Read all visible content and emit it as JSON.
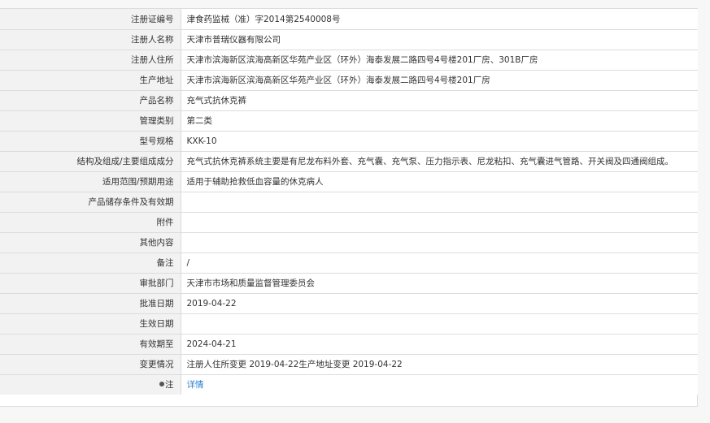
{
  "rows": [
    {
      "label": "注册证编号",
      "value": "津食药监械（准）字2014第2540008号"
    },
    {
      "label": "注册人名称",
      "value": "天津市普瑞仪器有限公司"
    },
    {
      "label": "注册人住所",
      "value": "天津市滨海新区滨海高新区华苑产业区（环外）海泰发展二路四号4号楼201厂房、301B厂房"
    },
    {
      "label": "生产地址",
      "value": "天津市滨海新区滨海高新区华苑产业区（环外）海泰发展二路四号4号楼201厂房"
    },
    {
      "label": "产品名称",
      "value": "充气式抗休克裤"
    },
    {
      "label": "管理类别",
      "value": "第二类"
    },
    {
      "label": "型号规格",
      "value": "KXK-10"
    },
    {
      "label": "结构及组成/主要组成成分",
      "value": "充气式抗休克裤系统主要是有尼龙布料外套、充气囊、充气泵、压力指示表、尼龙粘扣、充气囊进气管路、开关阀及四通阀组成。"
    },
    {
      "label": "适用范围/预期用途",
      "value": "适用于辅助抢救低血容量的休克病人"
    },
    {
      "label": "产品储存条件及有效期",
      "value": ""
    },
    {
      "label": "附件",
      "value": ""
    },
    {
      "label": "其他内容",
      "value": ""
    },
    {
      "label": "备注",
      "value": "/"
    },
    {
      "label": "审批部门",
      "value": "天津市市场和质量监督管理委员会"
    },
    {
      "label": "批准日期",
      "value": "2019-04-22"
    },
    {
      "label": "生效日期",
      "value": ""
    },
    {
      "label": "有效期至",
      "value": "2024-04-21"
    },
    {
      "label": "变更情况",
      "value": "注册人住所变更 2019-04-22生产地址变更 2019-04-22"
    }
  ],
  "note_row": {
    "label": "注",
    "icon": "pin-icon",
    "link_text": "详情",
    "link_color": "#2a7fd0"
  }
}
